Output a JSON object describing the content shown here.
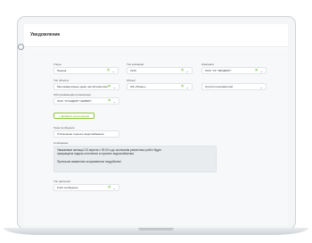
{
  "app": {
    "title": "Уведомление"
  },
  "row1": {
    "street": {
      "label": "Улица",
      "value": "Ленина"
    },
    "house": {
      "label": "Тип компании",
      "value": "ООО"
    },
    "company": {
      "label": "Компания",
      "value": "ООО \"УК \"ЭКОДОМ\"\""
    }
  },
  "row2": {
    "notice_type": {
      "label": "Тип объекта",
      "value": "Многоквартирные дома, жилой комплекс"
    },
    "object": {
      "label": "Объект",
      "value": "ЖК «Панно»"
    },
    "group": {
      "label": "",
      "value": "Группа пользователей"
    }
  },
  "row3": {
    "org": {
      "label": "Обслуживающая организация",
      "value": "ООО \"СТАНДАРТ СЕРВИС\""
    }
  },
  "add_button": {
    "label": "+ Добавить фильтрацию"
  },
  "topic": {
    "label": "Тема сообщения",
    "value": "Отключение горячего водоснабжения"
  },
  "message": {
    "label": "Сообщение",
    "line1": "Уважаемые жильцы! 23 апреля с 09.00 и до окончания ремонтных работ будет",
    "line2": "прекращена подача отопления и горячего водоснабжения.",
    "line3": "Приносим извинения за временные неудобства!"
  },
  "distribution": {
    "label": "Тип рассылки",
    "value": "Push-сообщение"
  },
  "icons": {
    "clear": "×",
    "chevron": "⌄",
    "row_marker": "○"
  },
  "colors": {
    "accent_green": "#6fbf3a",
    "field_bg": "#ffffff",
    "message_bg": "#e9ecef"
  }
}
